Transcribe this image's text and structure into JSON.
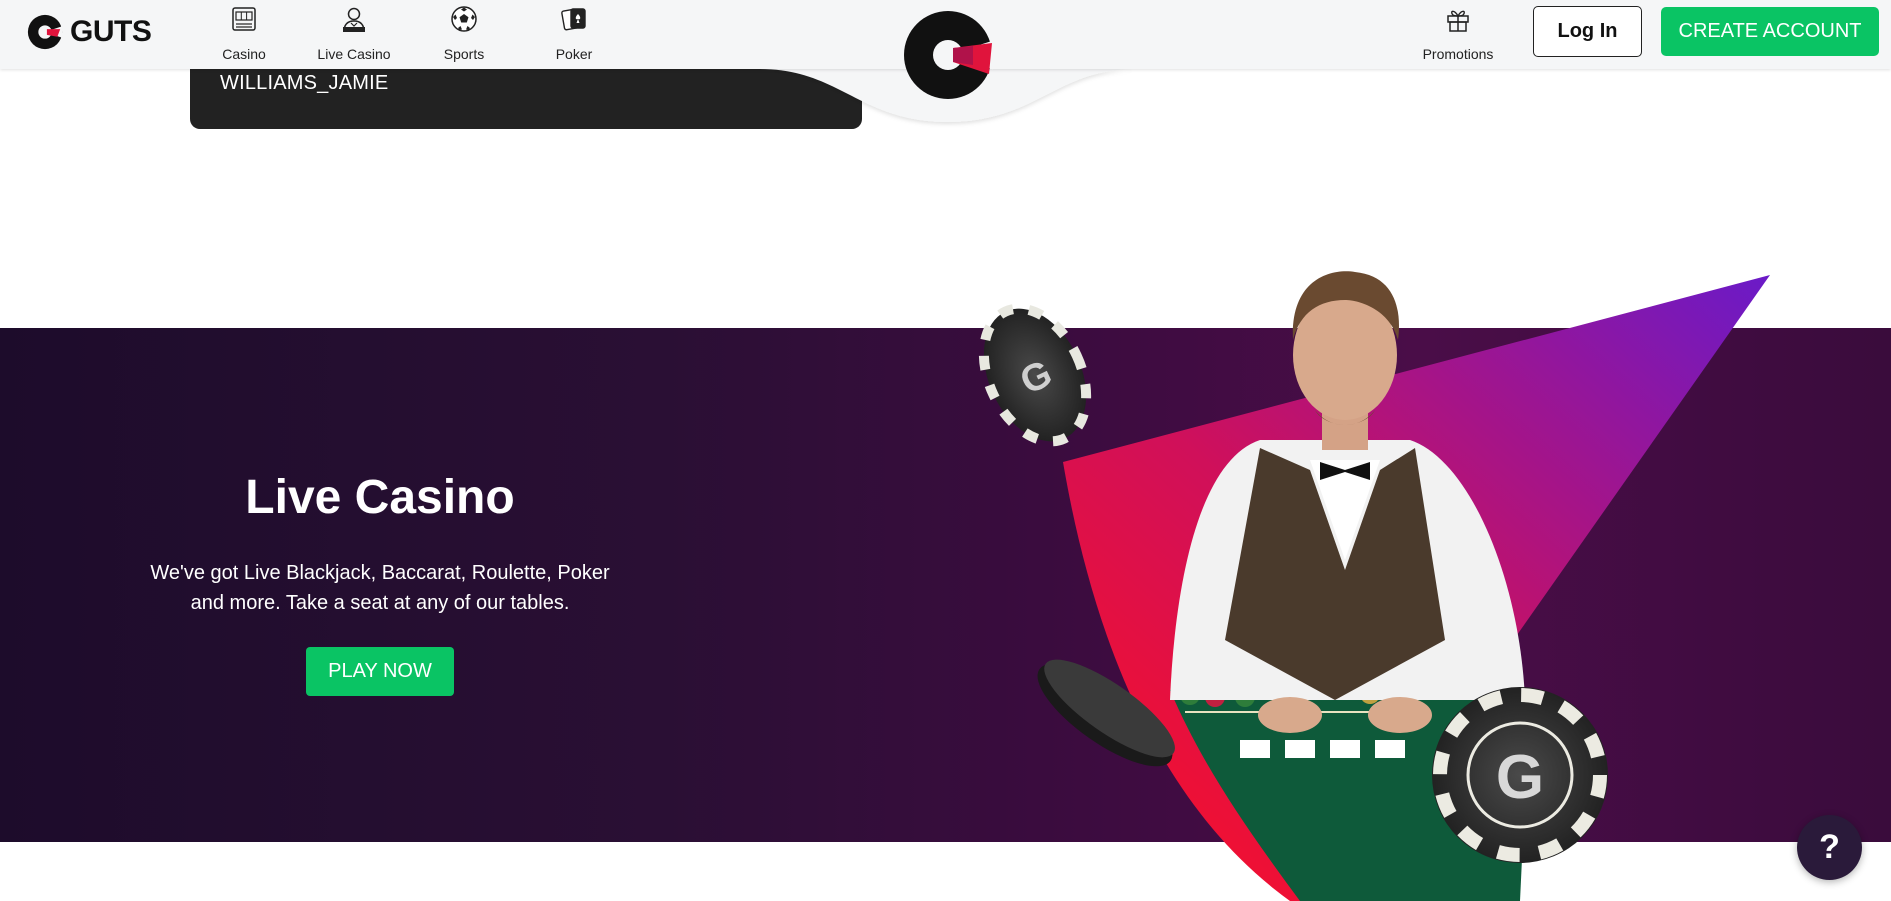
{
  "header": {
    "brand": {
      "name": "GUTS",
      "mark_colors": {
        "dark": "#111111",
        "accent": "#e0143c"
      }
    },
    "nav": [
      {
        "label": "Casino",
        "icon": "slot-machine-icon"
      },
      {
        "label": "Live Casino",
        "icon": "dealer-icon"
      },
      {
        "label": "Sports",
        "icon": "soccer-ball-icon"
      },
      {
        "label": "Poker",
        "icon": "playing-cards-icon"
      }
    ],
    "promotions": {
      "label": "Promotions",
      "icon": "gift-icon"
    },
    "login_label": "Log In",
    "create_account_label": "CREATE ACCOUNT"
  },
  "user_card": {
    "username": "WILLIAMS_JAMIE"
  },
  "banner": {
    "title": "Live Casino",
    "description": "We've got Live Blackjack, Baccarat, Roulette, Poker and more. Take a seat at any of our tables.",
    "cta_label": "PLAY NOW",
    "image_alt": "live-dealer-image"
  },
  "help": {
    "label": "?"
  },
  "colors": {
    "accent_green": "#0ac464",
    "banner_purple": "#2a0f34",
    "card_dark": "#222222",
    "triangle_red": "#ff1a2a",
    "triangle_violet": "#6a1ac8"
  }
}
